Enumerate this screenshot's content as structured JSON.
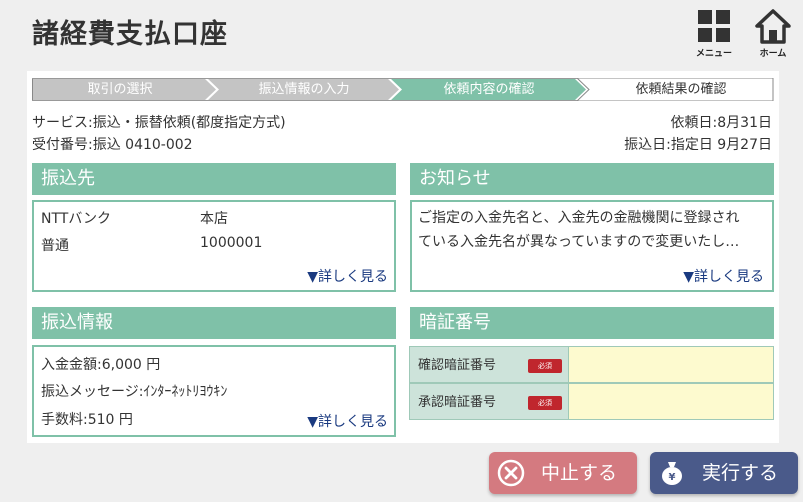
{
  "header": {
    "title": "諸経費支払口座",
    "menu_label": "メニュー",
    "home_label": "ホーム"
  },
  "steps": [
    {
      "label": "取引の選択",
      "state": "done"
    },
    {
      "label": "振込情報の入力",
      "state": "done"
    },
    {
      "label": "依頼内容の確認",
      "state": "active"
    },
    {
      "label": "依頼結果の確認",
      "state": "todo"
    }
  ],
  "info": {
    "service": "サービス:振込・振替依頼(都度指定方式)",
    "receipt": "受付番号:振込 0410-002",
    "request_date": "依頼日:8月31日",
    "transfer_date": "振込日:指定日 9月27日"
  },
  "payee": {
    "heading": "振込先",
    "bank": "NTTバンク",
    "branch": "本店",
    "account_type": "普通",
    "account_number": "1000001",
    "more": "▼詳しく見る"
  },
  "notice": {
    "heading": "お知らせ",
    "line1": "ご指定の入金先名と、入金先の金融機関に登録され",
    "line2": "ている入金先名が異なっていますので変更いたし…",
    "more": "▼詳しく見る"
  },
  "transfer": {
    "heading": "振込情報",
    "amount": "入金金額:6,000 円",
    "message": "振込メッセージ:ｲﾝﾀｰﾈｯﾄﾘﾖｳｷﾝ",
    "fee": "手数料:510 円",
    "more": "▼詳しく見る"
  },
  "pin": {
    "heading": "暗証番号",
    "confirm_label": "確認暗証番号",
    "approve_label": "承認暗証番号",
    "required": "必須"
  },
  "actions": {
    "cancel": "中止する",
    "execute": "実行する"
  },
  "colors": {
    "accent": "#7fc1a8",
    "step_done": "#c4c4c4",
    "cancel": "#d47a80",
    "execute": "#4a5a8a",
    "required": "#c0262d",
    "input_bg": "#fdfacf"
  }
}
